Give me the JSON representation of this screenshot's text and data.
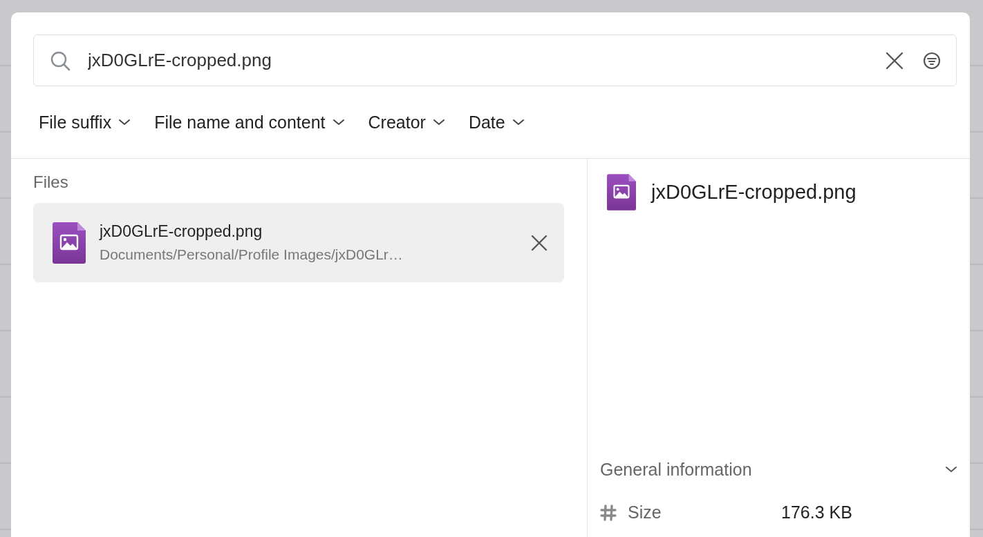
{
  "search": {
    "value": "jxD0GLrE-cropped.png"
  },
  "filters": [
    {
      "label": "File suffix"
    },
    {
      "label": "File name and content"
    },
    {
      "label": "Creator"
    },
    {
      "label": "Date"
    }
  ],
  "files": {
    "heading": "Files",
    "items": [
      {
        "name": "jxD0GLrE-cropped.png",
        "path": "Documents/Personal/Profile Images/jxD0GLr…",
        "selected": true
      }
    ]
  },
  "preview": {
    "name": "jxD0GLrE-cropped.png",
    "section": {
      "title": "General information",
      "expanded": true,
      "rows": [
        {
          "label": "Size",
          "value": "176.3 KB"
        }
      ]
    }
  }
}
